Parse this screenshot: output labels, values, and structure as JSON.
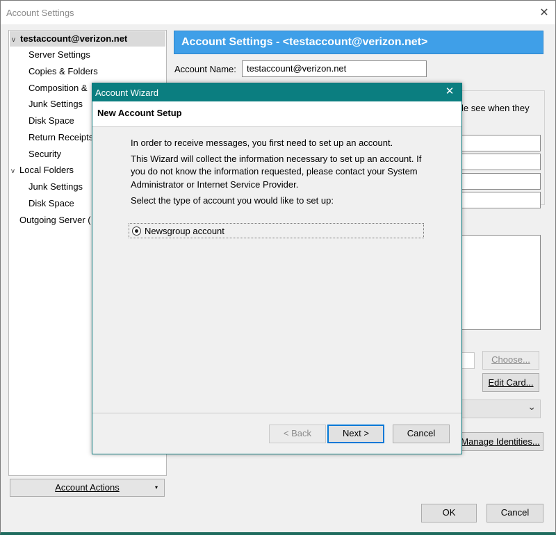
{
  "window": {
    "title": "Account Settings"
  },
  "tree": {
    "account": "testaccount@verizon.net",
    "account_children": [
      "Server Settings",
      "Copies & Folders",
      "Composition &",
      "Junk Settings",
      "Disk Space",
      "Return Receipts",
      "Security"
    ],
    "local_folders": "Local Folders",
    "local_children": [
      "Junk Settings",
      "Disk Space"
    ],
    "outgoing": "Outgoing Server ("
  },
  "account_actions": {
    "label": "Account Actions",
    "arrow": "▾"
  },
  "panel": {
    "banner": "Account Settings - <testaccount@verizon.net>",
    "account_name_label": "Account Name:",
    "account_name_value": "testaccount@verizon.net",
    "partial_text": "le see when they",
    "choose_button": "Choose...",
    "edit_card_button": "Edit Card...",
    "manage_identities_button": "Manage Identities...",
    "dropdown_arrow": "⌄"
  },
  "footer": {
    "ok": "OK",
    "cancel": "Cancel"
  },
  "wizard": {
    "title": "Account Wizard",
    "close_glyph": "✕",
    "header": "New Account Setup",
    "intro": "In order to receive messages, you first need to set up an account.",
    "info_lines": [
      "This Wizard will collect the information necessary to set up an account. If",
      "you do not know the information requested, please contact your System",
      "Administrator or Internet Service Provider."
    ],
    "select_prompt": "Select the type of account you would like to set up:",
    "option": "Newsgroup account",
    "back": "< Back",
    "next": "Next >",
    "cancel": "Cancel"
  }
}
